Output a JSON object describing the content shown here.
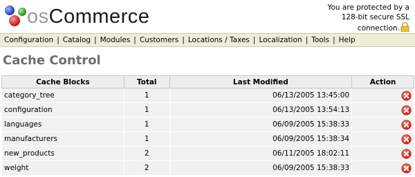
{
  "logo": {
    "part1": "os",
    "part2": "Commerce"
  },
  "ssl_notice": {
    "line1": "You are protected by a",
    "line2": "128-bit secure SSL",
    "line3": "connection.",
    "icon": "lock-icon"
  },
  "menu": [
    "Configuration",
    "Catalog",
    "Modules",
    "Customers",
    "Locations / Taxes",
    "Localization",
    "Tools",
    "Help"
  ],
  "page_title": "Cache Control",
  "table": {
    "headers": {
      "blocks": "Cache Blocks",
      "total": "Total",
      "modified": "Last Modified",
      "action": "Action"
    },
    "rows": [
      {
        "block": "category_tree",
        "total": "1",
        "modified": "06/13/2005 13:45:00"
      },
      {
        "block": "configuration",
        "total": "1",
        "modified": "06/13/2005 13:54:13"
      },
      {
        "block": "languages",
        "total": "1",
        "modified": "06/09/2005 15:38:33"
      },
      {
        "block": "manufacturers",
        "total": "1",
        "modified": "06/09/2005 15:38:34"
      },
      {
        "block": "new_products",
        "total": "2",
        "modified": "06/11/2005 18:02:11"
      },
      {
        "block": "weight",
        "total": "2",
        "modified": "06/09/2005 15:38:33"
      }
    ],
    "action_icon": "delete-icon"
  },
  "colors": {
    "menubar_bg": "#eeeed8",
    "title": "#6e6e6e",
    "delete": "#d43a2a"
  }
}
